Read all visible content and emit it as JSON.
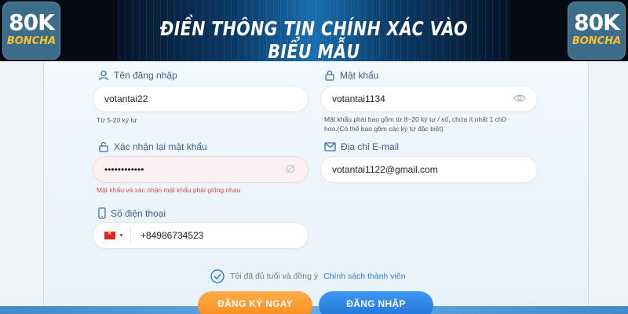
{
  "banner": {
    "title": "ĐIỀN THÔNG TIN CHÍNH XÁC VÀO BIỂU MẪU",
    "logo_main": "80K",
    "logo_sub": "BONCHA"
  },
  "form": {
    "username": {
      "label": "Tên đăng nhập",
      "value": "votantai22",
      "hint": "Từ 5-20 ký tự"
    },
    "password": {
      "label": "Mật khẩu",
      "value": "votantai1134",
      "hint_line1": "Mật khẩu phải bao gồm từ 8~20 ký tự / số, chứa ít nhất 1 chữ",
      "hint_line2": "hoa.(Có thể bao gồm các ký tự đặc biệt)"
    },
    "confirm_password": {
      "label": "Xác nhận lại mật khẩu",
      "value": "••••••••••••",
      "error": "Mật khẩu và xác nhận mật khẩu phải giống nhau"
    },
    "email": {
      "label": "Địa chỉ E-mail",
      "value": "votantai1122@gmail.com"
    },
    "phone": {
      "label": "Số điện thoại",
      "value": "+84986734523"
    },
    "agree": {
      "text": "Tôi đã đủ tuổi và đồng ý",
      "link": "Chính sách thành viên"
    },
    "register_button": "ĐĂNG KÝ NGAY",
    "login_button": "ĐĂNG NHẬP"
  }
}
